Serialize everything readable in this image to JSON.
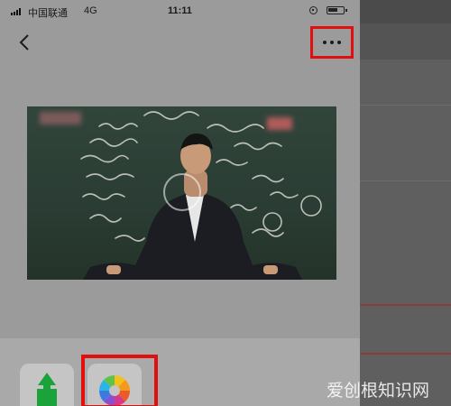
{
  "status_bar": {
    "carrier": "中国联通",
    "network": "4G",
    "time": "11:11",
    "signal_bars": 4,
    "battery_level": 0.7,
    "orientation_lock_icon": "orientation-lock-icon",
    "battery_icon": "battery-icon"
  },
  "nav": {
    "back_icon": "chevron-left-icon",
    "more_icon": "ellipsis-icon"
  },
  "video": {
    "play_icon": "play-ring-icon"
  },
  "share_sheet": {
    "apps": [
      {
        "icon": "share-upload-icon",
        "color": "#1aa33a"
      },
      {
        "icon": "photos-icon"
      }
    ]
  },
  "highlights": {
    "color": "#e01010"
  },
  "watermark": "爱创根知识网"
}
